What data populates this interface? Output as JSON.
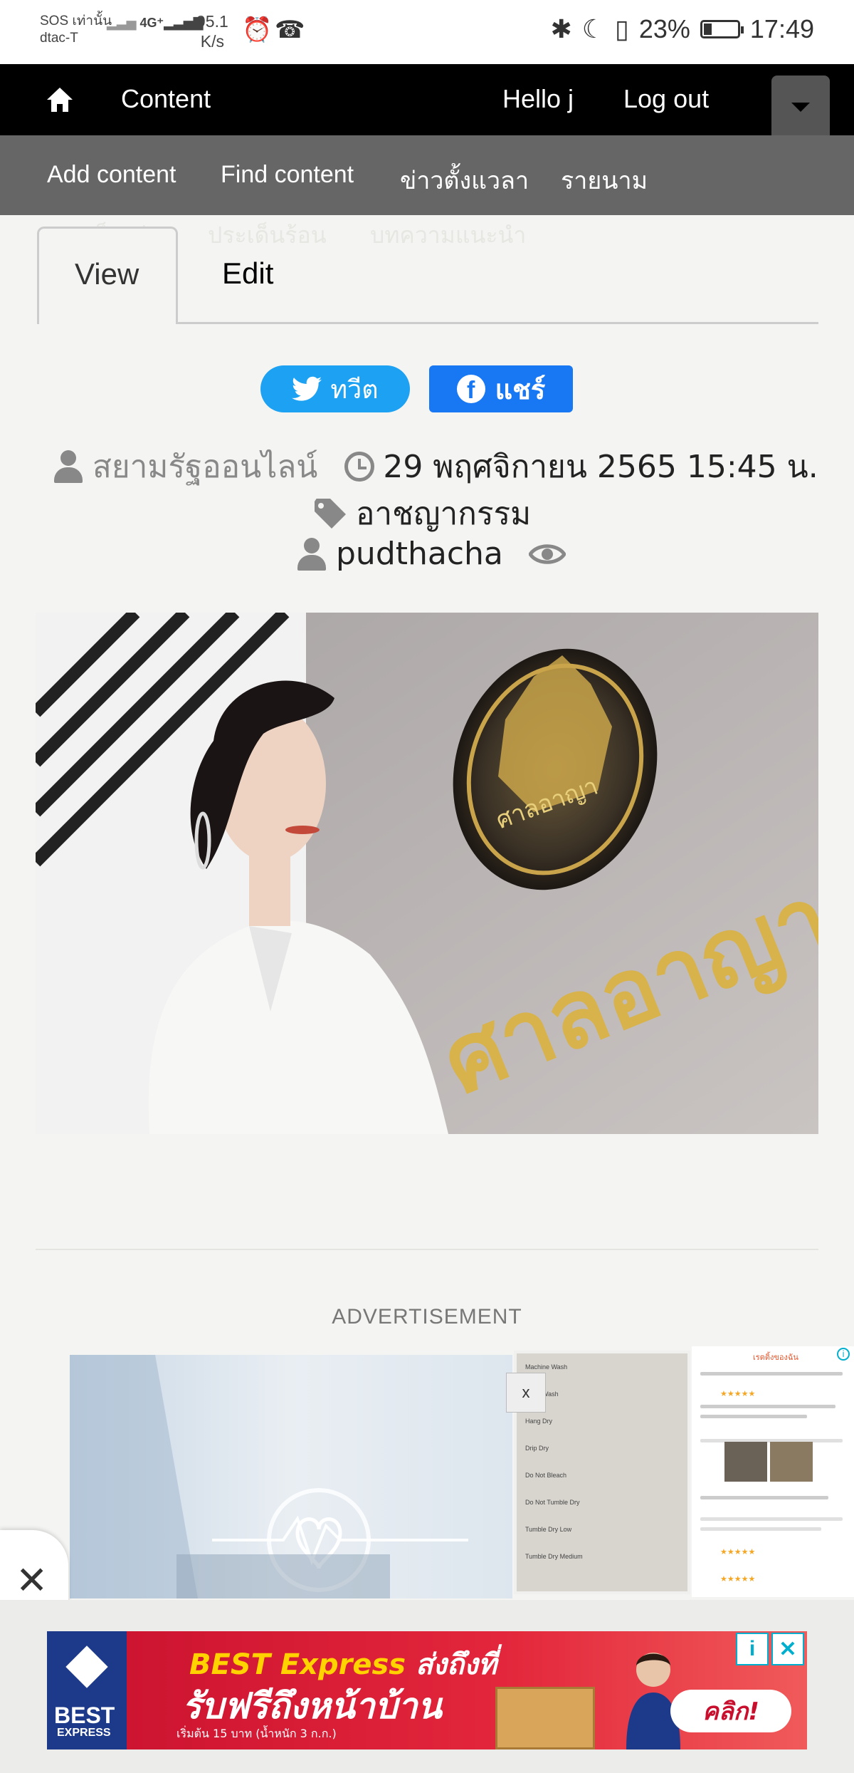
{
  "status_bar": {
    "carrier_line1": "SOS เท่านั้น",
    "carrier_line2": "dtac-T",
    "network": "4G⁺",
    "speed_value": "95.1",
    "speed_unit": "K/s",
    "battery": "23%",
    "battery_level": 0.23,
    "time": "17:49"
  },
  "toolbar": {
    "content_label": "Content",
    "hello_label": "Hello j",
    "logout_label": "Log out"
  },
  "submenu": {
    "items": [
      {
        "label": "Add content"
      },
      {
        "label": "Find content"
      },
      {
        "label": "ข่าวตั้งแวลา"
      },
      {
        "label": "รายนาม"
      }
    ],
    "overflow_items": [
      {
        "label": "ประเด็นเด่น"
      },
      {
        "label": "ประเด็นร้อน"
      },
      {
        "label": "บทความแนะนำ"
      }
    ]
  },
  "tabs": {
    "view_label": "View",
    "edit_label": "Edit"
  },
  "share": {
    "tweet_label": "ทวีต",
    "facebook_label": "แชร์"
  },
  "meta": {
    "source": "สยามรัฐออนไลน์",
    "date": "29 พฤศจิกายน 2565 15:45 น.",
    "category": "อาชญากรรม",
    "author": "pudthacha"
  },
  "hero": {
    "sign_text": "ศาลอาญา",
    "seal_text": "ศาลอาญา"
  },
  "ad": {
    "label": "ADVERTISEMENT",
    "close_x": "x",
    "care_labels": [
      "Machine Wash",
      "Hand Wash",
      "Hang Dry",
      "Drip Dry",
      "Do Not Bleach",
      "Do Not Tumble Dry",
      "Tumble Dry Low",
      "Tumble Dry Medium"
    ],
    "review_header": "เรตติ้งของฉัน",
    "close_float": "✕"
  },
  "banner": {
    "logo_text": "BEST",
    "logo_sub": "EXPRESS",
    "line1_brand": "BEST Express",
    "line1_rest": " ส่งถึงที่",
    "line2": "รับฟรีถึงหน้าบ้าน",
    "line3": "เริ่มต้น 15 บาท (น้ำหนัก 3 ก.ก.)",
    "cta": "คลิก!",
    "info_icon": "i",
    "close_icon": "✕"
  },
  "colors": {
    "toolbar_bg": "#000000",
    "submenu_bg": "#666666",
    "twitter": "#1da1f2",
    "facebook": "#1877f2",
    "banner_red": "#c8102e"
  }
}
